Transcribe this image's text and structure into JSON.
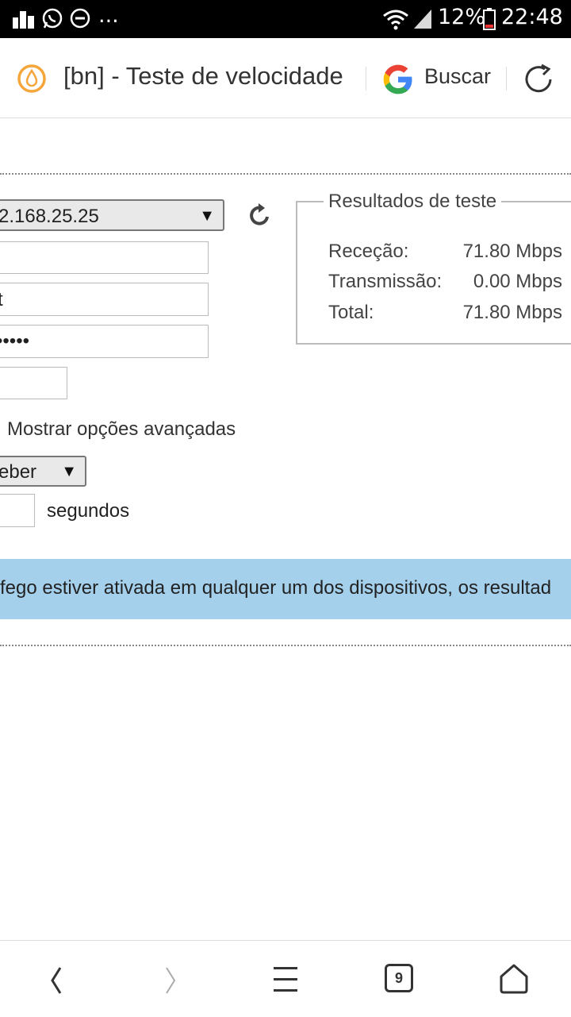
{
  "status_bar": {
    "battery": "12%",
    "time": "22:48",
    "ellipsis": "..."
  },
  "browser": {
    "page_title": "[bn] - Teste de velocidade",
    "search_label": "Buscar",
    "tab_count": "9"
  },
  "form": {
    "ip_select_value": "2.168.25.25",
    "username_value": "t",
    "password_mask": "•••••",
    "advanced_label": "Mostrar opções avançadas",
    "direction_select_value": "eber",
    "duration_unit": "segundos"
  },
  "results": {
    "legend": "Resultados de teste",
    "rows": [
      {
        "label": "Receção:",
        "value": "71.80 Mbps"
      },
      {
        "label": "Transmissão:",
        "value": "0.00 Mbps"
      },
      {
        "label": "Total:",
        "value": "71.80 Mbps"
      }
    ]
  },
  "banner": {
    "text": "fego estiver ativada em qualquer um dos dispositivos, os resultad"
  },
  "colors": {
    "banner_bg": "#a4d0ec",
    "toolbar_logo": "#f5a63a"
  }
}
